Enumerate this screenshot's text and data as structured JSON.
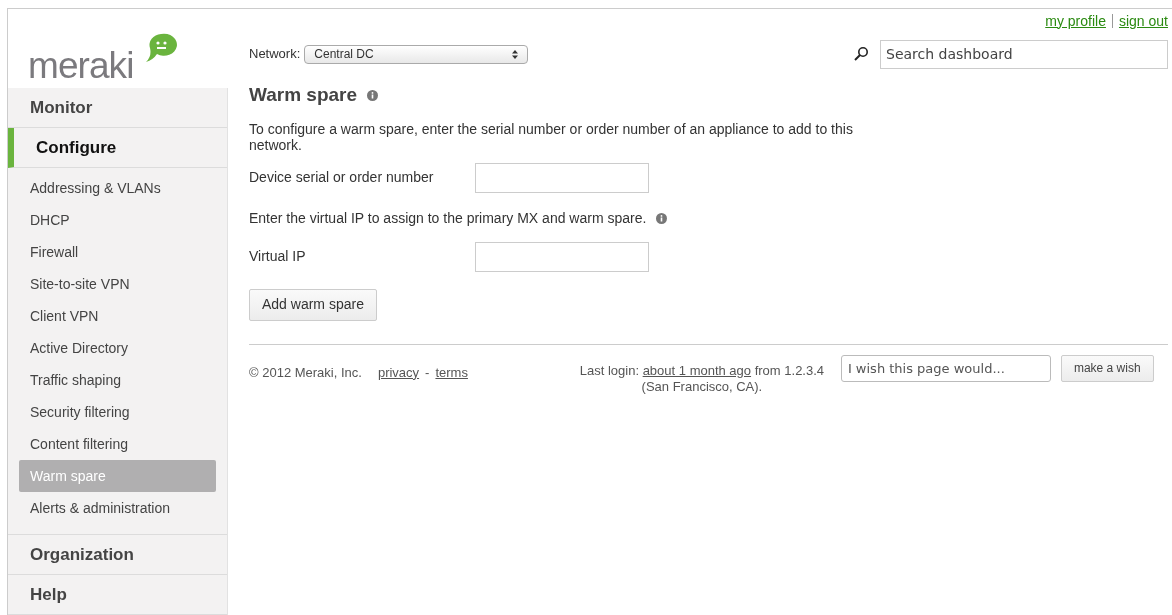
{
  "logo": {
    "text": "meraki"
  },
  "top_links": [
    "my profile",
    "sign out"
  ],
  "network": {
    "label": "Network:",
    "value": "Central DC"
  },
  "search": {
    "placeholder": "Search dashboard"
  },
  "sidebar": {
    "sections": [
      {
        "label": "Monitor",
        "selected": false
      },
      {
        "label": "Configure",
        "selected": true,
        "items": [
          {
            "label": "Addressing & VLANs",
            "selected": false
          },
          {
            "label": "DHCP",
            "selected": false
          },
          {
            "label": "Firewall",
            "selected": false
          },
          {
            "label": "Site-to-site VPN",
            "selected": false
          },
          {
            "label": "Client VPN",
            "selected": false
          },
          {
            "label": "Active Directory",
            "selected": false
          },
          {
            "label": "Traffic shaping",
            "selected": false
          },
          {
            "label": "Security filtering",
            "selected": false
          },
          {
            "label": "Content filtering",
            "selected": false
          },
          {
            "label": "Warm spare",
            "selected": true
          },
          {
            "label": "Alerts & administration",
            "selected": false
          }
        ]
      },
      {
        "label": "Organization",
        "selected": false
      },
      {
        "label": "Help",
        "selected": false
      }
    ]
  },
  "page": {
    "title": "Warm spare",
    "intro": "To configure a warm spare, enter the serial number or order number of an appliance to add to this network.",
    "serial_field": {
      "label": "Device serial or order number"
    },
    "vip_note": "Enter the virtual IP to assign to the primary MX and warm spare.",
    "vip_field": {
      "label": "Virtual IP"
    },
    "button": "Add warm spare"
  },
  "footer": {
    "copyright": "© 2012 Meraki, Inc.",
    "links": [
      "privacy",
      "terms"
    ],
    "separator": "-",
    "last_login": {
      "prefix": "Last login:",
      "link": "about 1 month ago",
      "suffix": "from 1.2.3.4 (San Francisco, CA)."
    },
    "wish": {
      "placeholder": "I wish this page would...",
      "button": "make a wish"
    }
  }
}
